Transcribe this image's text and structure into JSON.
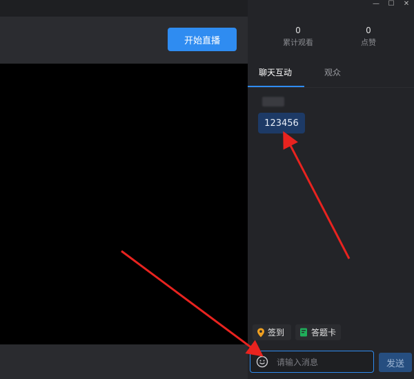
{
  "window": {
    "minimize_glyph": "—",
    "maximize_glyph": "☐",
    "close_glyph": "✕"
  },
  "header": {
    "start_live_label": "开始直播"
  },
  "stats": [
    {
      "value": "0",
      "label": "累计观看"
    },
    {
      "value": "0",
      "label": "点赞"
    }
  ],
  "tabs": [
    {
      "label": "聊天互动",
      "active": true
    },
    {
      "label": "观众",
      "active": false
    }
  ],
  "chat": {
    "messages": [
      {
        "text": "123456"
      }
    ]
  },
  "tools": {
    "checkin_label": "签到",
    "answer_card_label": "答题卡"
  },
  "composer": {
    "placeholder": "请输入消息",
    "send_label": "发送"
  },
  "colors": {
    "accent": "#2f8cf1",
    "arrow": "#e8231f",
    "bubble": "#1d3a66"
  }
}
